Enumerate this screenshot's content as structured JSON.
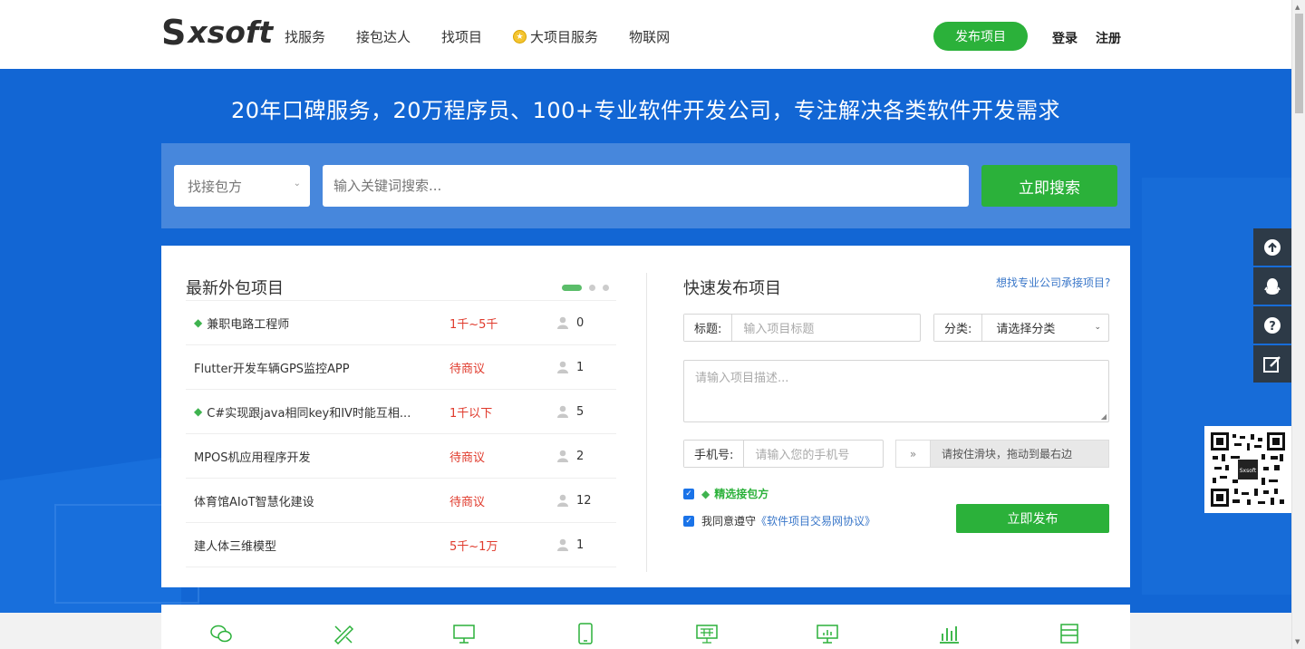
{
  "header": {
    "logo_s": "S",
    "logo_text": "xsoft",
    "nav": [
      {
        "label": "找服务"
      },
      {
        "label": "接包达人"
      },
      {
        "label": "找项目"
      },
      {
        "label": "大项目服务",
        "icon": "crown-icon"
      },
      {
        "label": "物联网"
      }
    ],
    "publish_label": "发布项目",
    "login_label": "登录",
    "register_label": "注册"
  },
  "banner": {
    "slogan": "20年口碑服务，20万程序员、100+专业软件开发公司，专注解决各类软件开发需求"
  },
  "search": {
    "select_value": "找接包方",
    "placeholder": "输入关键词搜索...",
    "button_label": "立即搜索"
  },
  "latest": {
    "title": "最新外包项目",
    "projects": [
      {
        "title": "兼职电路工程师",
        "featured": true,
        "price": "1千~5千",
        "count": "0"
      },
      {
        "title": "Flutter开发车辆GPS监控APP",
        "featured": false,
        "price": "待商议",
        "count": "1"
      },
      {
        "title": "C#实现跟java相同key和IV时能互相...",
        "featured": true,
        "price": "1千以下",
        "count": "5"
      },
      {
        "title": "MPOS机应用程序开发",
        "featured": false,
        "price": "待商议",
        "count": "2"
      },
      {
        "title": "体育馆AIoT智慧化建设",
        "featured": false,
        "price": "待商议",
        "count": "12"
      },
      {
        "title": "建人体三维模型",
        "featured": false,
        "price": "5千~1万",
        "count": "1"
      }
    ]
  },
  "quick_publish": {
    "title": "快速发布项目",
    "pro_link": "想找专业公司承接项目?",
    "title_label": "标题:",
    "title_placeholder": "输入项目标题",
    "category_label": "分类:",
    "category_value": "请选择分类",
    "desc_placeholder": "请输入项目描述...",
    "phone_label": "手机号:",
    "phone_placeholder": "请输入您的手机号",
    "slider_handle": "»",
    "slider_text": "请按住滑块，拖动到最右边",
    "check1_label": "精选接包方",
    "check2_prefix": "我同意遵守",
    "check2_link": "《软件项目交易网协议》",
    "submit_label": "立即发布"
  },
  "categories": [
    {
      "icon": "wechat-icon"
    },
    {
      "icon": "design-tools-icon"
    },
    {
      "icon": "desktop-icon"
    },
    {
      "icon": "mobile-icon"
    },
    {
      "icon": "web-grid-icon"
    },
    {
      "icon": "monitor-chart-icon"
    },
    {
      "icon": "bar-chart-icon"
    },
    {
      "icon": "database-icon"
    }
  ],
  "colors": {
    "brand_green": "#2bb13a",
    "banner_blue": "#1266d4",
    "price_red": "#e03a2c",
    "link_blue": "#3a77c9"
  }
}
